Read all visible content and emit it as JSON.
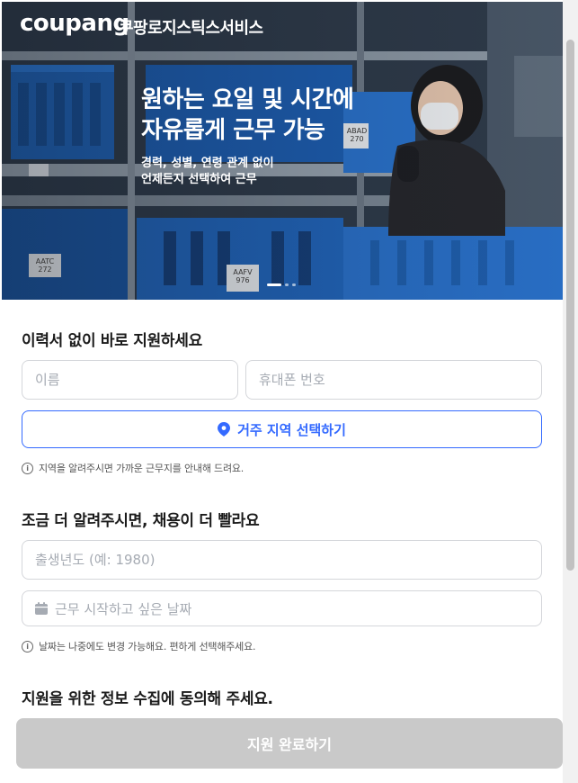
{
  "header": {
    "logo": "coupang",
    "service_name": "쿠팡로지스틱스서비스"
  },
  "hero": {
    "title_line1": "원하는 요일 및 시간에",
    "title_line2": "자유롭게 근무 가능",
    "subtitle_line1": "경력, 성별, 연령 관계 없이",
    "subtitle_line2": "언제든지 선택하여 근무",
    "bin_labels": [
      "ABAD 270",
      "AATC 272",
      "AAFV 976"
    ],
    "carousel": {
      "current": 1,
      "total": 3
    }
  },
  "section1": {
    "title": "이력서 없이 바로 지원하세요",
    "name_placeholder": "이름",
    "phone_placeholder": "휴대폰 번호",
    "region_button": "거주 지역 선택하기",
    "hint": "지역을 알려주시면 가까운 근무지를 안내해 드려요."
  },
  "section2": {
    "title": "조금 더 알려주시면, 채용이 더 빨라요",
    "birth_year_placeholder": "출생년도 (예: 1980)",
    "start_date_placeholder": "근무 시작하고 싶은 날짜",
    "hint": "날짜는 나중에도 변경 가능해요. 편하게 선택해주세요."
  },
  "section3": {
    "title": "지원을 위한 정보 수집에 동의해 주세요."
  },
  "submit_label": "지원 완료하기",
  "colors": {
    "accent": "#346aff",
    "submit_disabled": "#c9c9c9"
  },
  "icons": {
    "region": "location-pin-icon",
    "date": "calendar-icon",
    "hint": "info-icon"
  }
}
